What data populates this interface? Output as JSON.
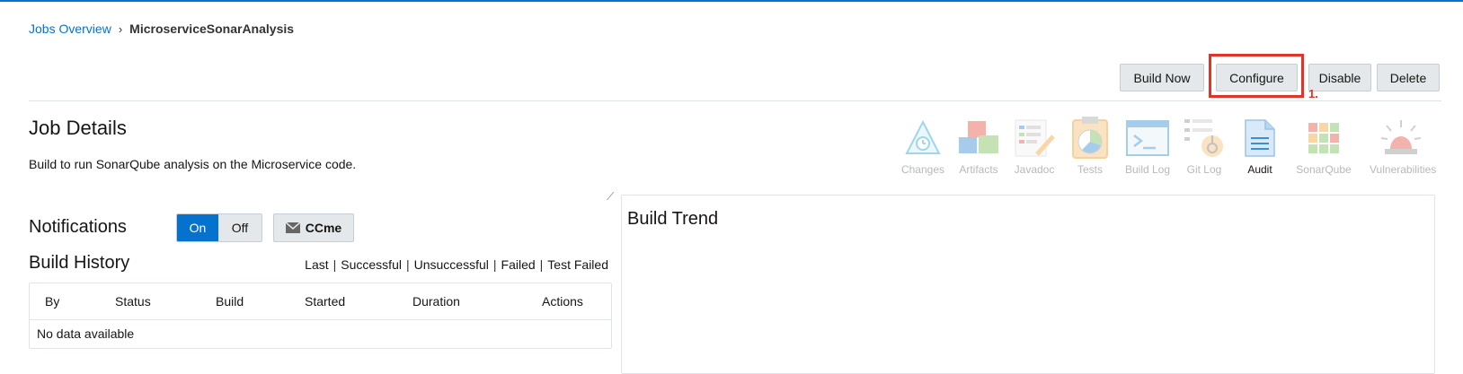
{
  "breadcrumb": {
    "parent": "Jobs Overview",
    "separator": "›",
    "current": "MicroserviceSonarAnalysis"
  },
  "actions": {
    "build_now": "Build Now",
    "configure": "Configure",
    "disable": "Disable",
    "delete": "Delete"
  },
  "annotation": {
    "step": "1."
  },
  "job": {
    "title": "Job Details",
    "description": "Build to run SonarQube analysis on the Microservice code."
  },
  "tools": [
    {
      "label": "Changes",
      "icon": "changes-icon"
    },
    {
      "label": "Artifacts",
      "icon": "artifacts-icon"
    },
    {
      "label": "Javadoc",
      "icon": "javadoc-icon"
    },
    {
      "label": "Tests",
      "icon": "tests-icon"
    },
    {
      "label": "Build Log",
      "icon": "build-log-icon"
    },
    {
      "label": "Git Log",
      "icon": "git-log-icon"
    },
    {
      "label": "Audit",
      "icon": "audit-icon"
    },
    {
      "label": "SonarQube",
      "icon": "sonarqube-icon"
    },
    {
      "label": "Vulnerabilities",
      "icon": "vulnerabilities-icon"
    }
  ],
  "notifications": {
    "title": "Notifications",
    "on": "On",
    "off": "Off",
    "ccme": "CCme"
  },
  "history": {
    "title": "Build History",
    "filters": [
      "Last",
      "Successful",
      "Unsuccessful",
      "Failed",
      "Test Failed"
    ],
    "columns": [
      "By",
      "Status",
      "Build",
      "Started",
      "Duration",
      "Actions"
    ],
    "empty": "No data available"
  },
  "trend": {
    "title": "Build Trend"
  },
  "colors": {
    "accent": "#0572ce",
    "highlight": "#e0342a"
  }
}
